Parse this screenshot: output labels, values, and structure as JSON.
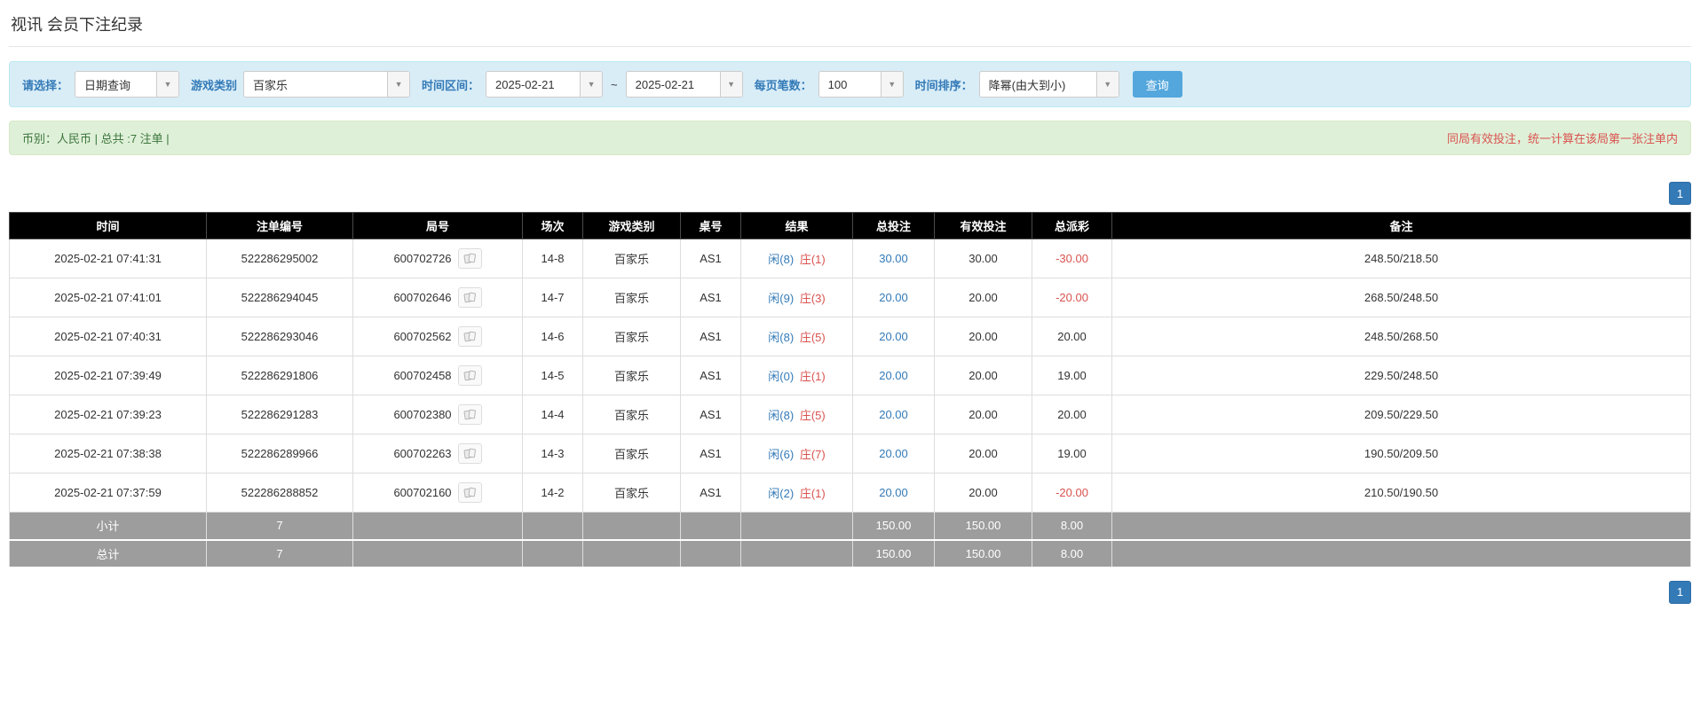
{
  "page": {
    "title": "视讯 会员下注纪录"
  },
  "colors": {
    "accent_blue": "#337ab7",
    "search_button_blue": "#54a7dc",
    "header_black": "#000000",
    "footer_gray": "#9d9d9d",
    "negative_red": "#d9534f",
    "banker_red": "#d9534f",
    "player_blue": "#337ab7",
    "success_green": "#3c763d",
    "notice_red": "#d9534f",
    "filter_bg": "#d9edf7",
    "info_bg": "#dff0d8"
  },
  "filters": {
    "select_label": "请选择：",
    "select_value": "日期查询",
    "game_type_label": "游戏类别",
    "game_type_value": "百家乐",
    "date_range_label": "时间区间：",
    "date_from": "2025-02-21",
    "date_separator": "~",
    "date_to": "2025-02-21",
    "per_page_label": "每页笔数：",
    "per_page_value": "100",
    "sort_label": "时间排序：",
    "sort_value": "降幂(由大到小)",
    "search_button": "查询",
    "dropdown_icon": "▼"
  },
  "info_bar": {
    "left": "币别：人民币 | 总共 :7 注单 |",
    "right": "同局有效投注，统一计算在该局第一张注单内"
  },
  "pagination": {
    "page": "1"
  },
  "table": {
    "headers": [
      "时间",
      "注单编号",
      "局号",
      "场次",
      "游戏类别",
      "桌号",
      "结果",
      "总投注",
      "有效投注",
      "总派彩",
      "备注"
    ],
    "rows": [
      {
        "time": "2025-02-21 07:41:31",
        "bet_id": "522286295002",
        "round_id": "600702726",
        "session": "14-8",
        "game": "百家乐",
        "table": "AS1",
        "result_player": "闲(8)",
        "result_banker": "庄(1)",
        "total_bet": "30.00",
        "valid_bet": "30.00",
        "payout": "-30.00",
        "remark": "248.50/218.50"
      },
      {
        "time": "2025-02-21 07:41:01",
        "bet_id": "522286294045",
        "round_id": "600702646",
        "session": "14-7",
        "game": "百家乐",
        "table": "AS1",
        "result_player": "闲(9)",
        "result_banker": "庄(3)",
        "total_bet": "20.00",
        "valid_bet": "20.00",
        "payout": "-20.00",
        "remark": "268.50/248.50"
      },
      {
        "time": "2025-02-21 07:40:31",
        "bet_id": "522286293046",
        "round_id": "600702562",
        "session": "14-6",
        "game": "百家乐",
        "table": "AS1",
        "result_player": "闲(8)",
        "result_banker": "庄(5)",
        "total_bet": "20.00",
        "valid_bet": "20.00",
        "payout": "20.00",
        "remark": "248.50/268.50"
      },
      {
        "time": "2025-02-21 07:39:49",
        "bet_id": "522286291806",
        "round_id": "600702458",
        "session": "14-5",
        "game": "百家乐",
        "table": "AS1",
        "result_player": "闲(0)",
        "result_banker": "庄(1)",
        "total_bet": "20.00",
        "valid_bet": "20.00",
        "payout": "19.00",
        "remark": "229.50/248.50"
      },
      {
        "time": "2025-02-21 07:39:23",
        "bet_id": "522286291283",
        "round_id": "600702380",
        "session": "14-4",
        "game": "百家乐",
        "table": "AS1",
        "result_player": "闲(8)",
        "result_banker": "庄(5)",
        "total_bet": "20.00",
        "valid_bet": "20.00",
        "payout": "20.00",
        "remark": "209.50/229.50"
      },
      {
        "time": "2025-02-21 07:38:38",
        "bet_id": "522286289966",
        "round_id": "600702263",
        "session": "14-3",
        "game": "百家乐",
        "table": "AS1",
        "result_player": "闲(6)",
        "result_banker": "庄(7)",
        "total_bet": "20.00",
        "valid_bet": "20.00",
        "payout": "19.00",
        "remark": "190.50/209.50"
      },
      {
        "time": "2025-02-21 07:37:59",
        "bet_id": "522286288852",
        "round_id": "600702160",
        "session": "14-2",
        "game": "百家乐",
        "table": "AS1",
        "result_player": "闲(2)",
        "result_banker": "庄(1)",
        "total_bet": "20.00",
        "valid_bet": "20.00",
        "payout": "-20.00",
        "remark": "210.50/190.50"
      }
    ],
    "subtotal": {
      "label": "小计",
      "count": "7",
      "total_bet": "150.00",
      "valid_bet": "150.00",
      "payout": "8.00"
    },
    "total": {
      "label": "总计",
      "count": "7",
      "total_bet": "150.00",
      "valid_bet": "150.00",
      "payout": "8.00"
    }
  }
}
